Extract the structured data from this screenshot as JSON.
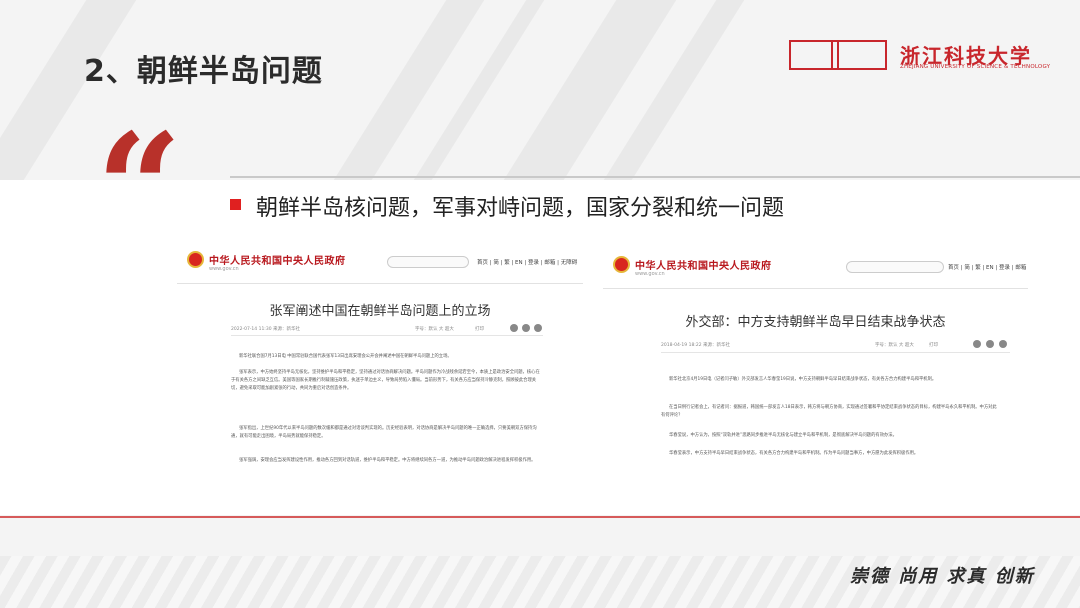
{
  "slide": {
    "title": "2、朝鲜半岛问题",
    "headline": "朝鲜半岛核问题，军事对峙问题，国家分裂和统一问题",
    "quote_mark": "“",
    "motto": "崇德 尚用 求真 创新"
  },
  "logo": {
    "name": "浙江科技大学",
    "subtitle": "ZHEJIANG UNIVERSITY OF SCIENCE & TECHNOLOGY"
  },
  "colors": {
    "accent": "#c8262c",
    "quote": "#b8312a",
    "bullet": "#e02020"
  },
  "screenshot_left": {
    "site_name": "中华人民共和国中央人民政府",
    "site_url": "www.gov.cn",
    "nav": "首页 | 简 | 繁 | EN | 登录 | 邮箱 | 无障碍",
    "article_title": "张军阐述中国在朝鲜半岛问题上的立场",
    "date_source": "2022-07-14  11:30   来源：新华社",
    "font_size": "字号：默认  大  超大",
    "actions": "打印",
    "paragraphs": [
      "新华社联合国7月13日电  中国常驻联合国代表张军13日出席安理会公开会并阐述中国在朝鲜半岛问题上的立场。",
      "张军表示，中方始终坚持半岛无核化，坚持维护半岛和平稳定，坚持通过对话协商解决问题。半岛问题作为冷战残余延宕至今，本质上是政治安全问题，核心在于有关各方之间缺乏互信。美国等国家长期推行制裁施压政策，执迷于单边主义，导致局势陷入僵局。当前形势下，有关各方应当保持冷静克制，照顾彼此合理关切，避免采取可能加剧紧张的行动，共同为重启对话创造条件。",
      "张军指出，上世纪90年代以来半岛问题的数次缓和都是通过对话谈判实现的。历史经验表明，对话协商是解决半岛问题的唯一正确选择，只要美朝双方保持沟通，就有可能走出困境，半岛局势就能保持稳定。",
      "张军强调，安理会应当发挥建设性作用，推动各方回到对话轨道，维护半岛和平稳定。中方将继续同各方一道，为推动半岛问题政治解决进程发挥积极作用。"
    ]
  },
  "screenshot_right": {
    "site_name": "中华人民共和国中央人民政府",
    "site_url": "www.gov.cn",
    "nav": "首页 | 简 | 繁 | EN | 登录 | 邮箱 | 无障碍",
    "article_title": "外交部：中方支持朝鲜半岛早日结束战争状态",
    "date_source": "2018-04-19  18:22   来源：新华社",
    "font_size": "字号：默认  大  超大",
    "actions": "打印",
    "paragraphs": [
      "新华社北京4月19日电（记者闫子敏）外交部发言人华春莹19日说，中方支持朝鲜半岛早日结束战争状态，有关各方合力构建半岛和平机制。",
      "在当日例行记者会上，有记者问：据报道，韩国统一部发言人18日表示，韩方将与朝方协商，实现通过签署和平协定结束战争状态的目标，构建半岛永久和平机制。中方对此有何评论？",
      "华春莹说，中方认为，按照“双轨并进”思路同步推进半岛无核化与建立半岛和平机制，是彻底解决半岛问题的有效办法。",
      "华春莹表示，中方支持半岛早日结束战争状态，有关各方合力构建半岛和平机制。作为半岛问题当事方，中方愿为此发挥积极作用。"
    ]
  }
}
